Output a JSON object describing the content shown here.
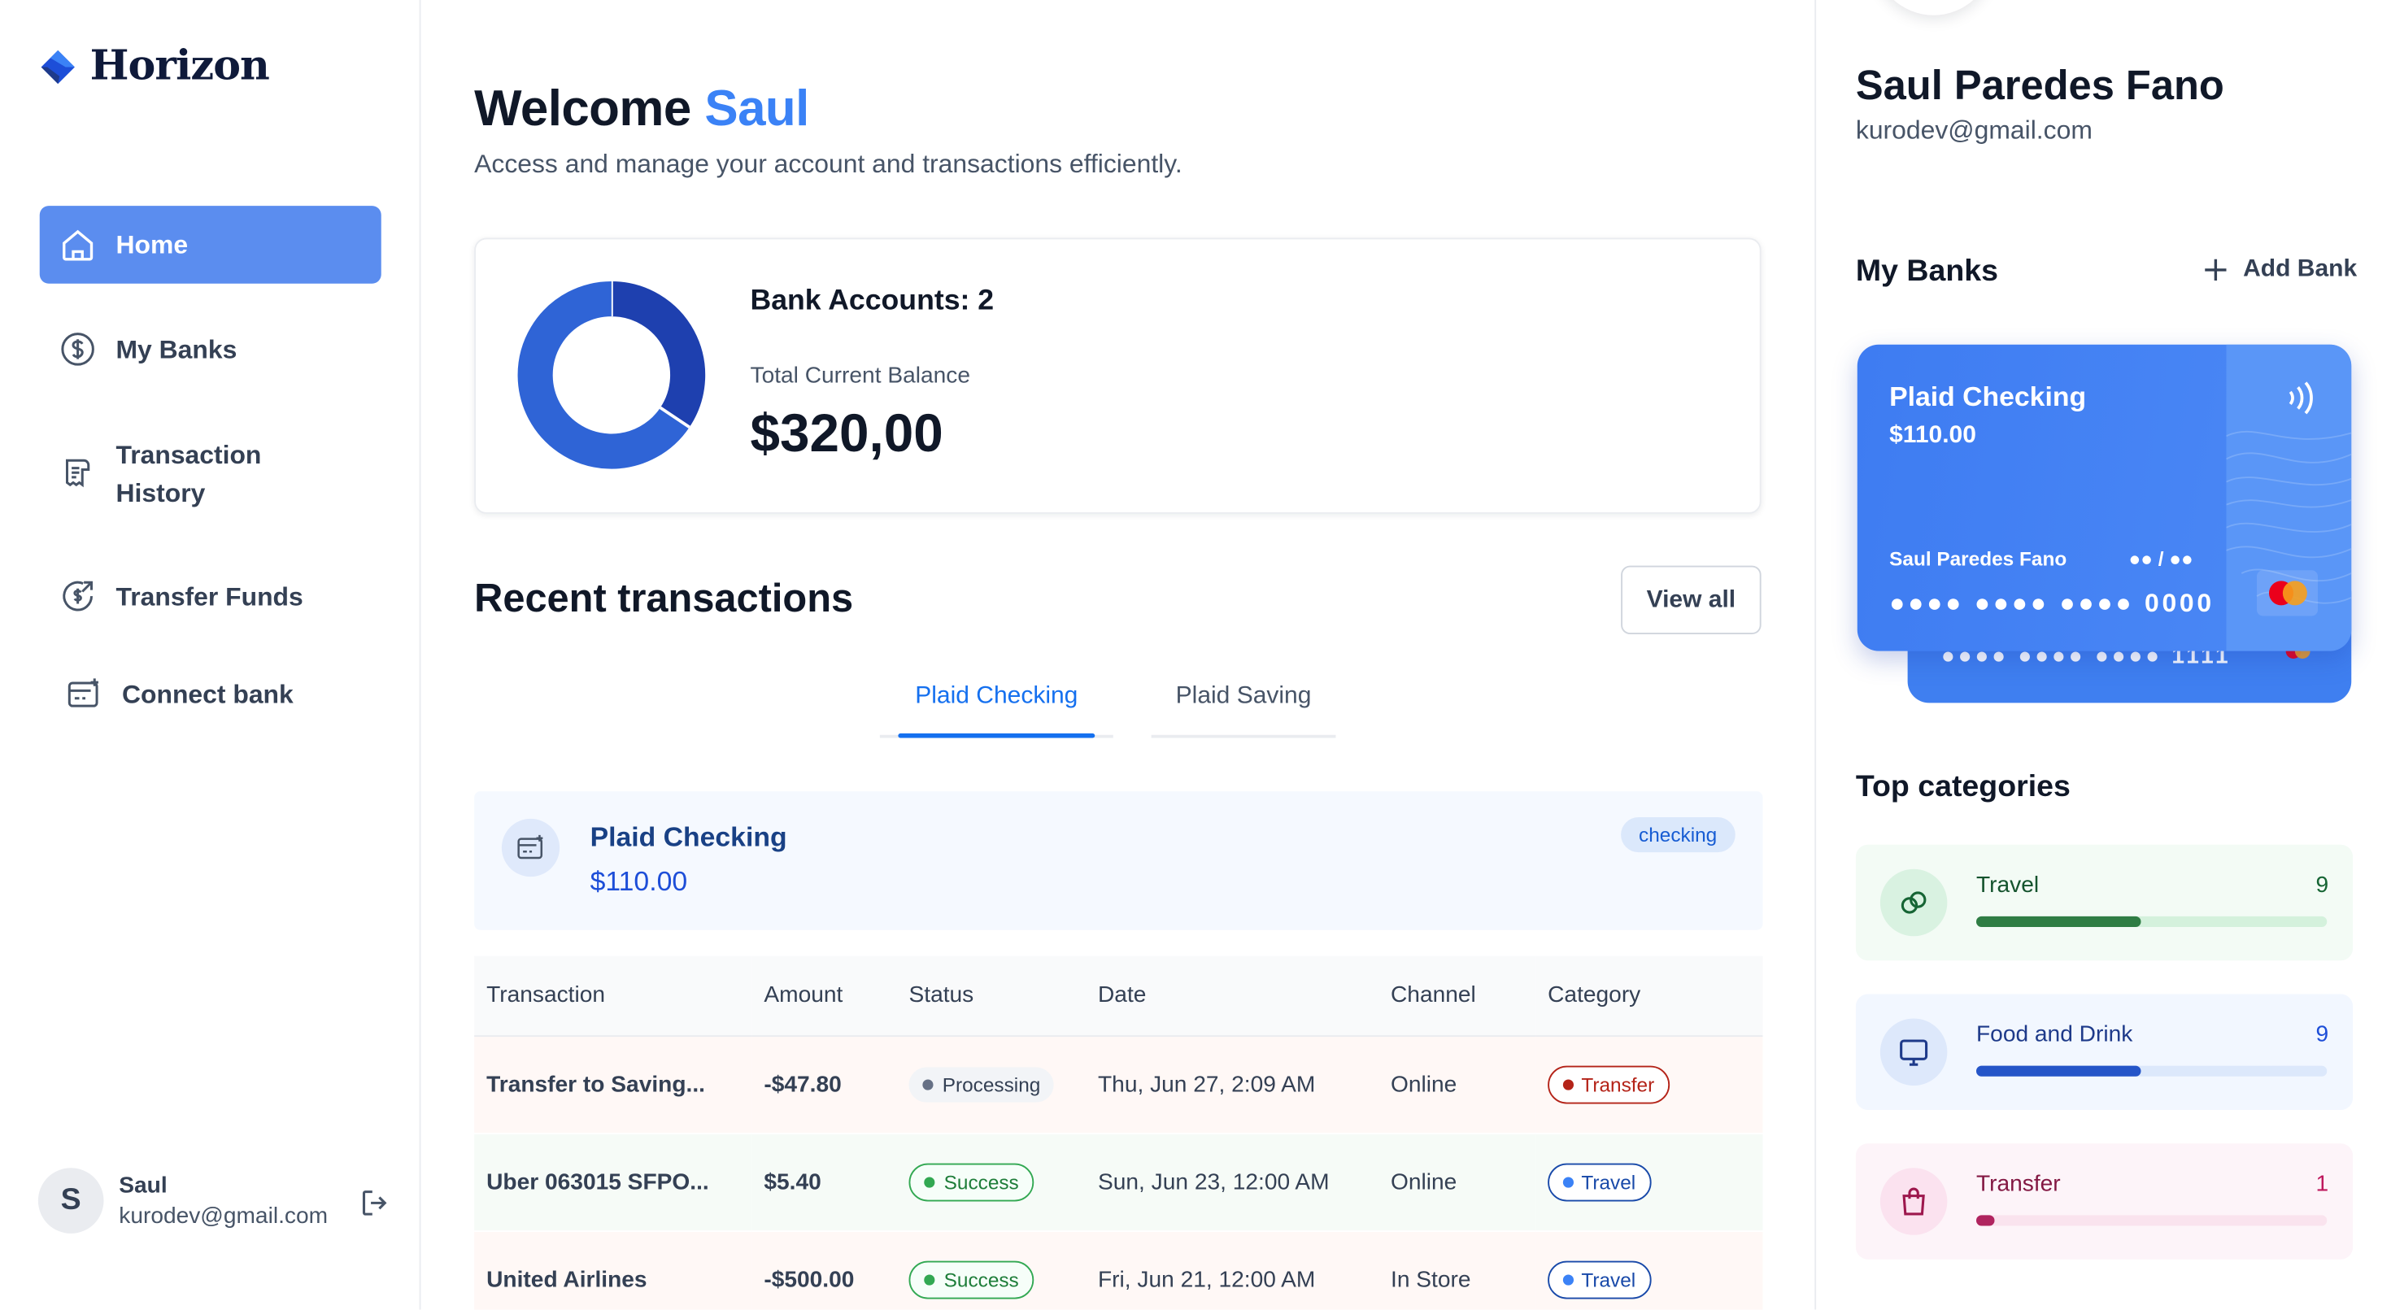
{
  "brand": {
    "name": "Horizon"
  },
  "sidebar": {
    "items": [
      {
        "label": "Home",
        "icon": "home-icon",
        "active": true
      },
      {
        "label": "My Banks",
        "icon": "dollar-circle-icon",
        "active": false
      },
      {
        "label": "Transaction History",
        "icon": "receipt-icon",
        "active": false
      },
      {
        "label": "Transfer Funds",
        "icon": "transfer-money-icon",
        "active": false
      },
      {
        "label": "Connect bank",
        "icon": "connect-bank-icon",
        "active": false
      }
    ],
    "user": {
      "initial": "S",
      "name": "Saul",
      "email": "kurodev@gmail.com"
    }
  },
  "header": {
    "welcome_prefix": "Welcome",
    "welcome_name": "Saul",
    "subtitle": "Access and manage your account and transactions efficiently."
  },
  "balance": {
    "bank_accounts_label": "Bank Accounts: 2",
    "total_label": "Total Current Balance",
    "total_amount": "$320,00"
  },
  "chart_data": {
    "type": "pie",
    "categories": [
      "Plaid Checking",
      "Plaid Saving"
    ],
    "values": [
      110,
      210
    ],
    "colors": [
      "#1e40af",
      "#2f64d6"
    ]
  },
  "recent": {
    "title": "Recent transactions",
    "view_all": "View all",
    "tabs": [
      {
        "label": "Plaid Checking",
        "active": true
      },
      {
        "label": "Plaid Saving",
        "active": false
      }
    ],
    "account": {
      "name": "Plaid Checking",
      "balance": "$110.00",
      "type": "checking"
    },
    "columns": [
      "Transaction",
      "Amount",
      "Status",
      "Date",
      "Channel",
      "Category"
    ],
    "rows": [
      {
        "name": "Transfer to Saving...",
        "amount": "-$47.80",
        "status": "Processing",
        "date": "Thu, Jun 27, 2:09 AM",
        "channel": "Online",
        "category": "Transfer"
      },
      {
        "name": "Uber 063015 SFPO...",
        "amount": "$5.40",
        "status": "Success",
        "date": "Sun, Jun 23, 12:00 AM",
        "channel": "Online",
        "category": "Travel"
      },
      {
        "name": "United Airlines",
        "amount": "-$500.00",
        "status": "Success",
        "date": "Fri, Jun 21, 12:00 AM",
        "channel": "In Store",
        "category": "Travel"
      }
    ]
  },
  "profile": {
    "name": "Saul Paredes Fano",
    "email": "kurodev@gmail.com"
  },
  "my_banks": {
    "title": "My Banks",
    "add_label": "Add Bank",
    "front_card": {
      "name": "Plaid Checking",
      "balance": "$110.00",
      "holder": "Saul Paredes Fano",
      "expiry": "●● / ●●",
      "number": "●●●● ●●●● ●●●● 0000"
    },
    "back_card": {
      "number": "●●●● ●●●● ●●●● 1111"
    }
  },
  "top_categories": {
    "title": "Top categories",
    "items": [
      {
        "name": "Travel",
        "count": "9",
        "progress": 0.47
      },
      {
        "name": "Food and Drink",
        "count": "9",
        "progress": 0.47
      },
      {
        "name": "Transfer",
        "count": "1",
        "progress": 0.05
      }
    ]
  }
}
